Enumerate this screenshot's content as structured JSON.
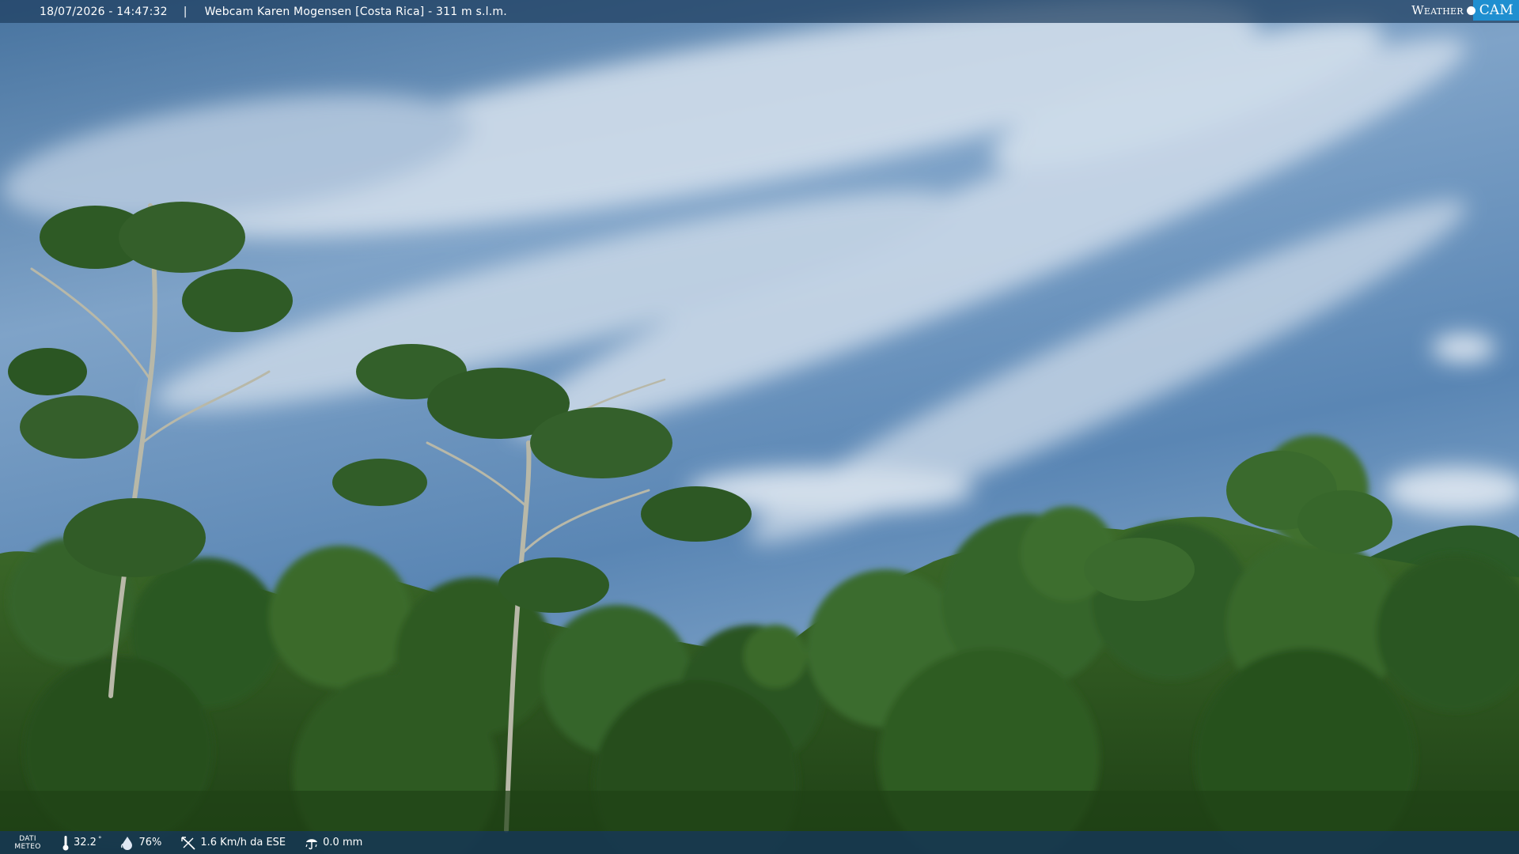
{
  "header": {
    "timestamp": "18/07/2026 - 14:47:32",
    "separator": "|",
    "title": "Webcam Karen Mogensen [Costa Rica] - 311 m s.l.m.",
    "brand_word": "Weather",
    "brand_cam": "CAM"
  },
  "footer": {
    "dati_line1": "DATI",
    "dati_line2": "METEO",
    "temperature": "32.2",
    "temperature_unit": "°",
    "humidity": "76%",
    "wind": "1.6 Km/h da ESE",
    "rain": "0.0 mm"
  },
  "colors": {
    "sky_top": "#3f6d9c",
    "sky_mid": "#6f98c2",
    "sky_low": "#9cbad6",
    "foliage_dark": "#1c3d14",
    "foliage_mid": "#2f5d1f",
    "foliage_light": "#4f7d35",
    "brand_accent": "#1f8fd0"
  },
  "icons": {
    "temperature": "thermometer-icon",
    "humidity": "droplet-icon",
    "wind": "wind-direction-icon",
    "rain": "rain-gauge-icon"
  }
}
